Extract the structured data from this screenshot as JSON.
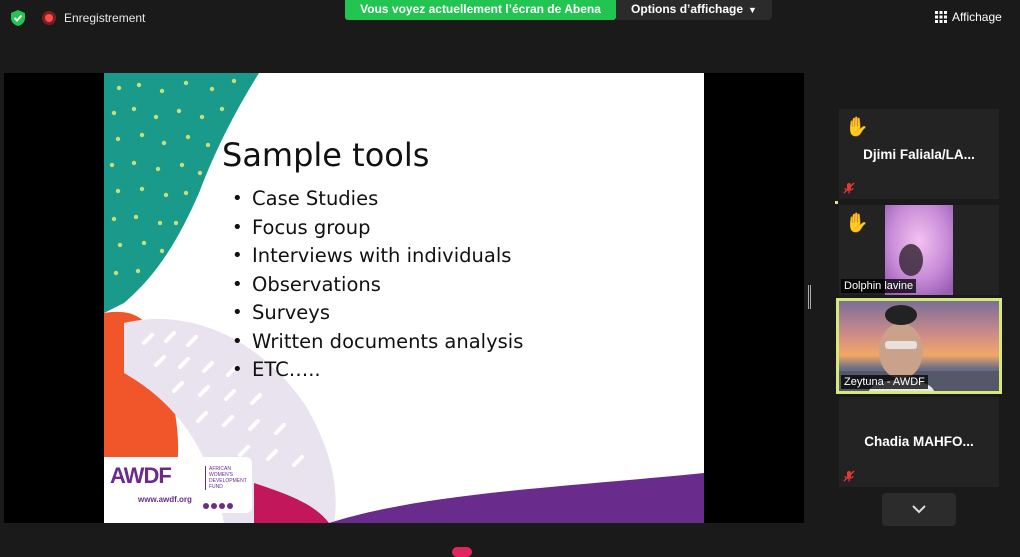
{
  "header": {
    "recording_label": "Enregistrement",
    "share_banner": "Vous voyez actuellement l’écran de Abena",
    "view_options_label": "Options d’affichage",
    "display_label": "Affichage"
  },
  "slide": {
    "title": "Sample tools",
    "bullets": [
      "Case Studies",
      "Focus group",
      "Interviews with individuals",
      "Observations",
      "Surveys",
      "Written documents analysis",
      "ETC….."
    ],
    "logo_text": "AWDF",
    "logo_subtext": "AFRICAN WOMEN'S DEVELOPMENT FUND",
    "logo_url": "www.awdf.org"
  },
  "participants": [
    {
      "name": "Djimi  Faliala/LA...",
      "hand_raised": true,
      "muted": true,
      "video": false
    },
    {
      "name": "Dolphin lavine",
      "hand_raised": true,
      "muted": false,
      "video": true
    },
    {
      "name": "Zeytuna - AWDF",
      "hand_raised": false,
      "muted": false,
      "video": true,
      "active_speaker": true
    },
    {
      "name": "Chadia  MAHFO...",
      "hand_raised": false,
      "muted": true,
      "video": false
    }
  ],
  "colors": {
    "share_banner": "#23c552",
    "active_speaker_border": "#d6ea7a",
    "slide_teal": "#1a9a8a",
    "slide_orange": "#f0562a",
    "slide_purple": "#6a2c8c",
    "slide_magenta": "#c2185b"
  }
}
